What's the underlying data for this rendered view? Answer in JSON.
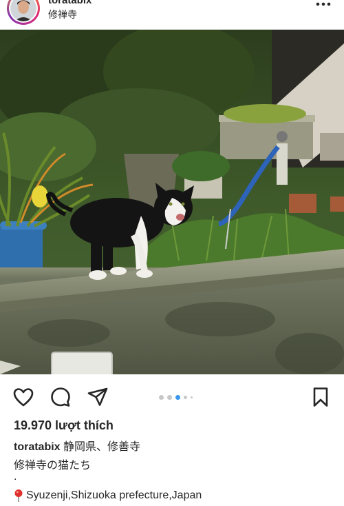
{
  "header": {
    "username": "toratabix",
    "location": "修禅寺"
  },
  "icons": {
    "more": "more-horizontal-icon",
    "like": "heart-icon",
    "comment": "comment-icon",
    "share": "send-icon",
    "save": "bookmark-icon",
    "location_pin": "round-pushpin-icon"
  },
  "carousel": {
    "total": 5,
    "active_index": 2
  },
  "post": {
    "likes_text": "19.970 lượt thích",
    "caption_username": "toratabix",
    "caption_text": "静岡県、修善寺",
    "caption_line2": "修禅寺の猫たち",
    "caption_dot": ".",
    "caption_location": "Syuzenji,Shizuoka prefecture,Japan"
  },
  "colors": {
    "accent": "#3897f0",
    "text": "#262626",
    "dot_inactive": "#c7c7c7"
  }
}
